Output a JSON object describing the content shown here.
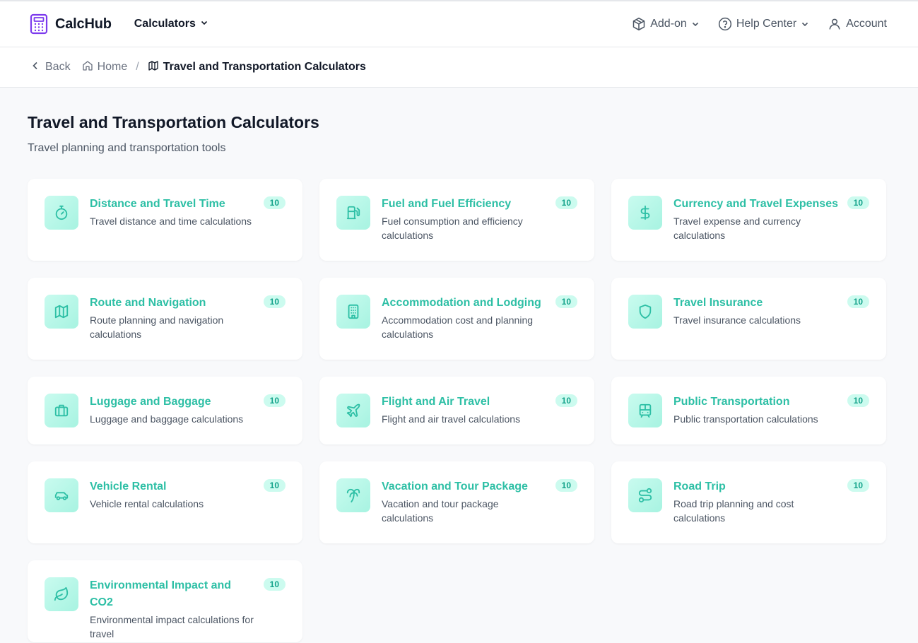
{
  "header": {
    "brand": "CalcHub",
    "calculators_menu": "Calculators",
    "addon": "Add-on",
    "help": "Help Center",
    "account": "Account"
  },
  "breadcrumb": {
    "back": "Back",
    "home": "Home",
    "separator": "/",
    "current": "Travel and Transportation Calculators"
  },
  "page": {
    "title": "Travel and Transportation Calculators",
    "subtitle": "Travel planning and transportation tools"
  },
  "colors": {
    "accent": "#2dbfa5",
    "brand_icon": "#7c3aed",
    "icon_bg": "#b7f7e6",
    "badge_bg": "#ccfbef"
  },
  "categories": [
    {
      "title": "Distance and Travel Time",
      "desc": "Travel distance and time calculations",
      "count": "10",
      "icon": "stopwatch-icon"
    },
    {
      "title": "Fuel and Fuel Efficiency",
      "desc": "Fuel consumption and efficiency calculations",
      "count": "10",
      "icon": "fuel-pump-icon"
    },
    {
      "title": "Currency and Travel Expenses",
      "desc": "Travel expense and currency calculations",
      "count": "10",
      "icon": "dollar-icon"
    },
    {
      "title": "Route and Navigation",
      "desc": "Route planning and navigation calculations",
      "count": "10",
      "icon": "map-icon"
    },
    {
      "title": "Accommodation and Lodging",
      "desc": "Accommodation cost and planning calculations",
      "count": "10",
      "icon": "building-icon"
    },
    {
      "title": "Travel Insurance",
      "desc": "Travel insurance calculations",
      "count": "10",
      "icon": "shield-icon"
    },
    {
      "title": "Luggage and Baggage",
      "desc": "Luggage and baggage calculations",
      "count": "10",
      "icon": "luggage-icon"
    },
    {
      "title": "Flight and Air Travel",
      "desc": "Flight and air travel calculations",
      "count": "10",
      "icon": "plane-icon"
    },
    {
      "title": "Public Transportation",
      "desc": "Public transportation calculations",
      "count": "10",
      "icon": "bus-icon"
    },
    {
      "title": "Vehicle Rental",
      "desc": "Vehicle rental calculations",
      "count": "10",
      "icon": "car-icon"
    },
    {
      "title": "Vacation and Tour Package",
      "desc": "Vacation and tour package calculations",
      "count": "10",
      "icon": "palm-tree-icon"
    },
    {
      "title": "Road Trip",
      "desc": "Road trip planning and cost calculations",
      "count": "10",
      "icon": "route-icon"
    },
    {
      "title": "Environmental Impact and CO2",
      "desc": "Environmental impact calculations for travel",
      "count": "10",
      "icon": "leaf-icon"
    }
  ]
}
